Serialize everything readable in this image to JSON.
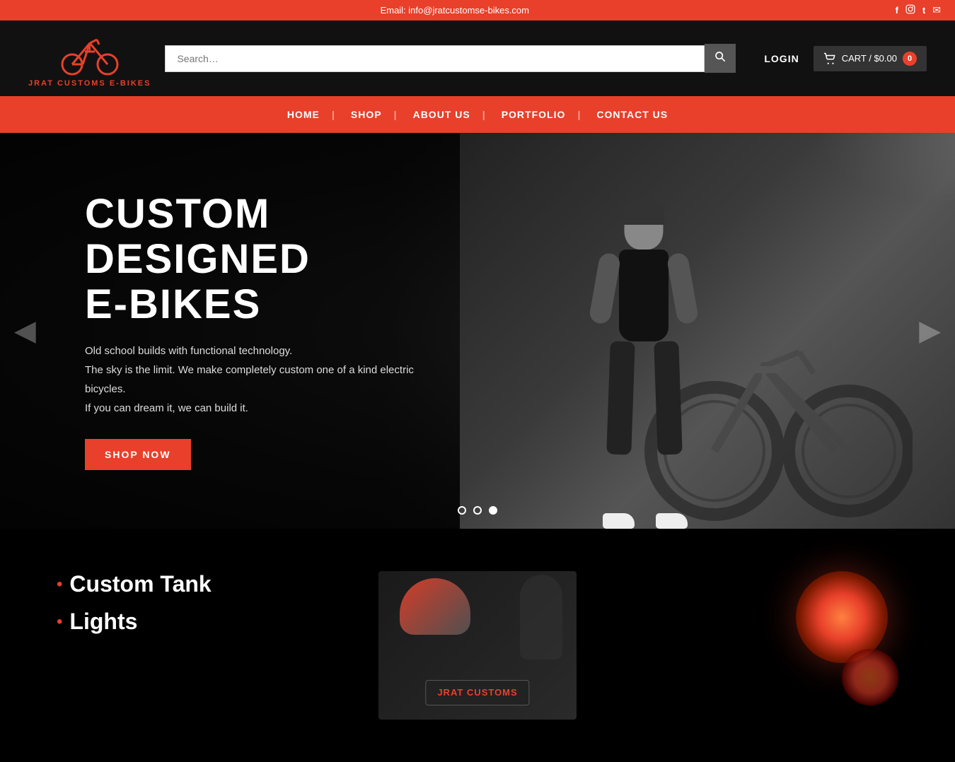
{
  "topbar": {
    "email_label": "Email: info@jratcustomse-bikes.com"
  },
  "header": {
    "logo_text": "JRAT CUSTOMS E-BIKES",
    "search_placeholder": "Search…",
    "login_label": "LOGIN",
    "cart_label": "CART / $0.00",
    "cart_count": "0"
  },
  "nav": {
    "items": [
      {
        "label": "HOME",
        "id": "home"
      },
      {
        "label": "SHOP",
        "id": "shop"
      },
      {
        "label": "ABOUT US",
        "id": "about"
      },
      {
        "label": "PORTFOLIO",
        "id": "portfolio"
      },
      {
        "label": "CONTACT US",
        "id": "contact"
      }
    ]
  },
  "hero": {
    "title_line1": "CUSTOM DESIGNED",
    "title_line2": "E-BIKES",
    "subtitle_line1": "Old school builds with functional technology.",
    "subtitle_line2": "The sky is the limit. We make completely custom one of a kind electric bicycles.",
    "subtitle_line3": "If you can dream it, we can build it.",
    "cta_label": "SHOP NOW",
    "dots": [
      {
        "id": 1,
        "active": false
      },
      {
        "id": 2,
        "active": false
      },
      {
        "id": 3,
        "active": true
      }
    ]
  },
  "features": {
    "item1_bullet": "•",
    "item1_label": "Custom Tank",
    "item2_bullet": "•",
    "item2_label": "Lights"
  },
  "social_icons": {
    "facebook": "f",
    "instagram": "📷",
    "twitter": "t",
    "email": "✉"
  }
}
